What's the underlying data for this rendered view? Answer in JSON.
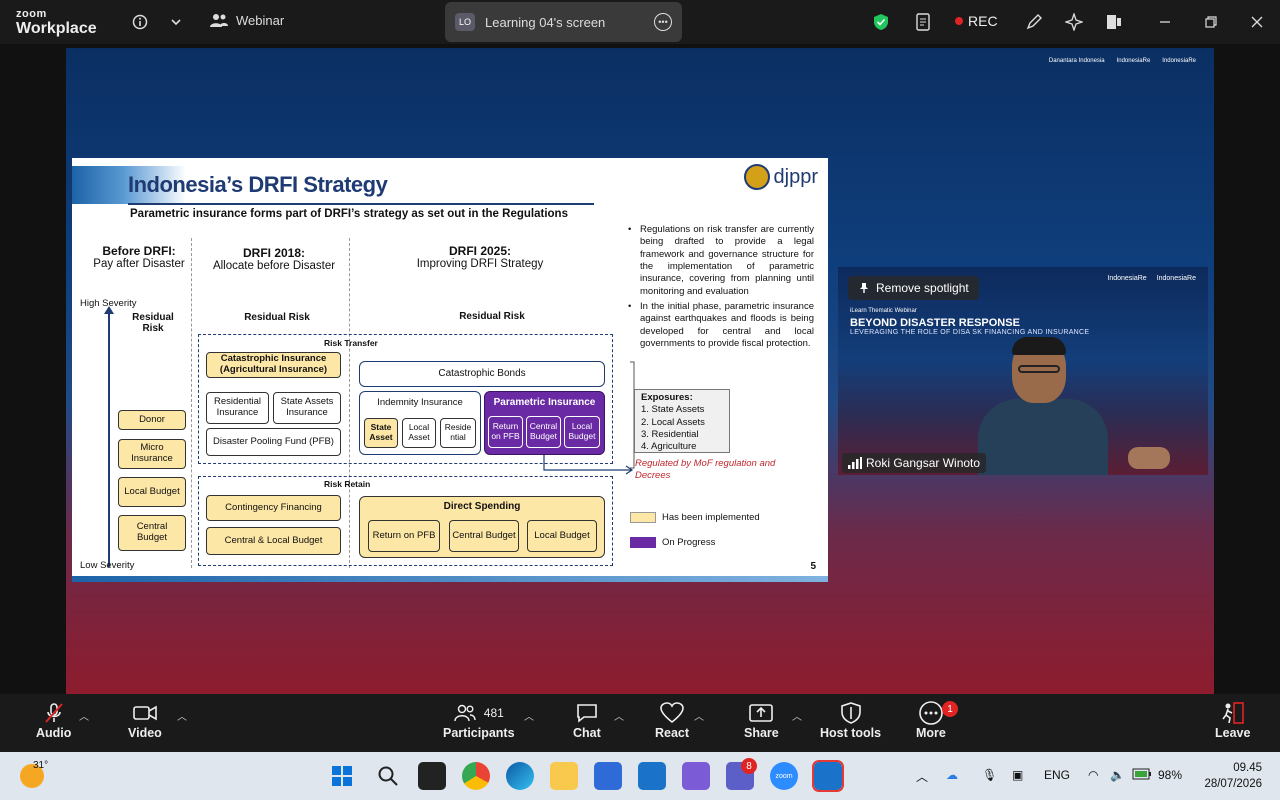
{
  "app": {
    "brand_top": "zoom",
    "brand_bottom": "Workplace",
    "mode_label": "Webinar"
  },
  "screen_share": {
    "initials": "LO",
    "label": "Learning 04's screen"
  },
  "recording": {
    "label": "REC"
  },
  "stage": {
    "logo_1": "Danantara Indonesia",
    "logo_2": "IndonesiaRe",
    "logo_3": "IndonesiaRe"
  },
  "slide": {
    "title": "Indonesia’s DRFI Strategy",
    "subtitle": "Parametric insurance forms part of DRFI’s strategy as set out in the Regulations",
    "logo": "djppr",
    "col1": {
      "head": "Before DRFI:",
      "sub": "Pay after Disaster"
    },
    "col2": {
      "head": "DRFI 2018:",
      "sub": "Allocate before Disaster"
    },
    "col3": {
      "head": "DRFI 2025:",
      "sub": "Improving DRFI Strategy"
    },
    "high_severity": "High Severity",
    "low_severity": "Low Severity",
    "residual_risk_1": "Residual Risk",
    "residual_risk_2": "Residual Risk",
    "residual_risk_3": "Residual Risk",
    "risk_transfer": "Risk Transfer",
    "risk_retain": "Risk Retain",
    "left_boxes": [
      "Donor",
      "Micro Insurance",
      "Local Budget",
      "Central Budget"
    ],
    "cat_insurance": "Catastrophic Insurance (Agricultural Insurance)",
    "residential_insurance": "Residential Insurance",
    "state_assets_insurance": "State Assets Insurance",
    "pooling_fund": "Disaster Pooling Fund (PFB)",
    "cat_bonds": "Catastrophic Bonds",
    "indemnity": "Indemnity Insurance",
    "indemnity_items": [
      "State Asset",
      "Local Asset",
      "Reside ntial"
    ],
    "parametric": "Parametric Insurance",
    "parametric_items": [
      "Return on PFB",
      "Central Budget",
      "Local Budget"
    ],
    "contingency": "Contingency Financing",
    "central_local": "Central & Local Budget",
    "direct_spending": "Direct Spending",
    "direct_items": [
      "Return on PFB",
      "Central Budget",
      "Local Budget"
    ],
    "bullets": [
      "Regulations on risk transfer are currently being drafted to provide a legal framework and governance structure for the implementation of parametric insurance, covering from planning until monitoring and evaluation",
      "In the initial phase, parametric insurance against earthquakes and floods is being developed for central and local governments to provide fiscal protection."
    ],
    "exposures_title": "Exposures:",
    "exposures": [
      "1.  State Assets",
      "2.  Local Assets",
      "3.  Residential",
      "4.  Agriculture"
    ],
    "regulated_note": "Regulated by MoF regulation and Decrees",
    "legend_implemented": "Has been implemented",
    "legend_progress": "On Progress",
    "page_number": "5"
  },
  "video": {
    "spotlight_button": "Remove spotlight",
    "webinar_small": "iLearn Thematic Webinar",
    "webinar_title": "BEYOND DISASTER RESPONSE",
    "webinar_sub": "LEVERAGING THE ROLE OF DISA       SK FINANCING AND INSURANCE",
    "logo_1": "IndonesiaRe",
    "logo_2": "IndonesiaRe",
    "participant_name": "Roki Gangsar Winoto"
  },
  "toolbar": {
    "audio": "Audio",
    "video": "Video",
    "participants": "Participants",
    "participants_count": "481",
    "chat": "Chat",
    "react": "React",
    "share": "Share",
    "host_tools": "Host tools",
    "more": "More",
    "more_badge": "1",
    "leave": "Leave"
  },
  "taskbar": {
    "weather": "31°",
    "teams_badge": "8",
    "language": "ENG",
    "battery": "98%",
    "time": "09.45",
    "date": "28/07/2026"
  },
  "colors": {
    "implemented": "#fde7a6",
    "on_progress": "#6a2aa3",
    "rec": "#e02424",
    "shield": "#22c55e"
  }
}
